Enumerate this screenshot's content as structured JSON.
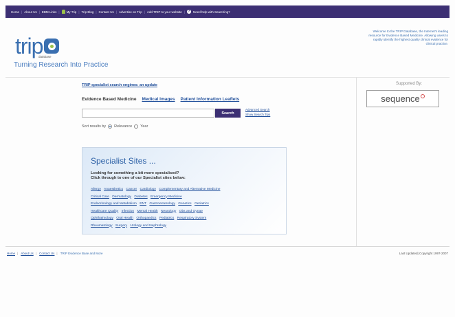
{
  "topnav": {
    "items": [
      "Home",
      "About Us",
      "EBM Links",
      "My Trip",
      "Trip Blog",
      "Contact Us",
      "Advertise on Trip",
      "Add TRIP to your website"
    ],
    "help": "Need help with Searching?"
  },
  "logo": {
    "text": "trip",
    "sub": "database"
  },
  "tagline": "Turning Research Into Practice",
  "welcome": "Welcome to the TRIP Database, the Internet's leading resource for Evidence Based Medicine. Allowing users to rapidly identify the highest quality clinical evidence for clinical practice.",
  "supported": {
    "label": "Supported By:",
    "sponsor": "sequence"
  },
  "update_link": "TRIP specialist search engines: an update",
  "tabs": {
    "active": "Evidence Based Medicine",
    "images": "Medical Images",
    "leaflets": "Patient Information Leaflets"
  },
  "search": {
    "value": "",
    "button": "Search",
    "advanced": "Advanced Search",
    "tips": "Show Search Tips"
  },
  "sort": {
    "label": "Sort results by",
    "relevance": "Relevance",
    "year": "Year",
    "selected": "Relevance"
  },
  "specialist": {
    "title": "Specialist Sites ...",
    "intro1": "Looking for something a bit more specialised?",
    "intro2": "Click through to one of our Specialist sites below:",
    "rows": [
      [
        "Allergy",
        "Anaesthetics",
        "Cancer",
        "Cardiology",
        "Complementary and Alternative Medicine"
      ],
      [
        "Critical Care",
        "Dermatology",
        "Diabetes",
        "Emergency Medicine"
      ],
      [
        "Endocrinology and Metabolism",
        "ENT",
        "Gastroenterology",
        "Genetics",
        "Geriatrics"
      ],
      [
        "Healthcare Quality",
        "Infection",
        "Mental Health",
        "Neurology",
        "Obs and Gynae"
      ],
      [
        "Ophthalmology",
        "Oral Health",
        "Orthopaedics",
        "Pediatrics",
        "Respiratory System"
      ],
      [
        "Rheumatology",
        "Surgery",
        "Urology and Nephrology"
      ]
    ]
  },
  "footer": {
    "home": "Home",
    "about": "About Us",
    "contact": "Contact Us",
    "current": "TRIP Evidence Base and More",
    "last_updated": "Last Updated",
    "copyright": "Copyright 1997-2007"
  },
  "colors": {
    "nav": "#3c2f73",
    "accent": "#3a6fb0",
    "green": "#9bc14a"
  }
}
